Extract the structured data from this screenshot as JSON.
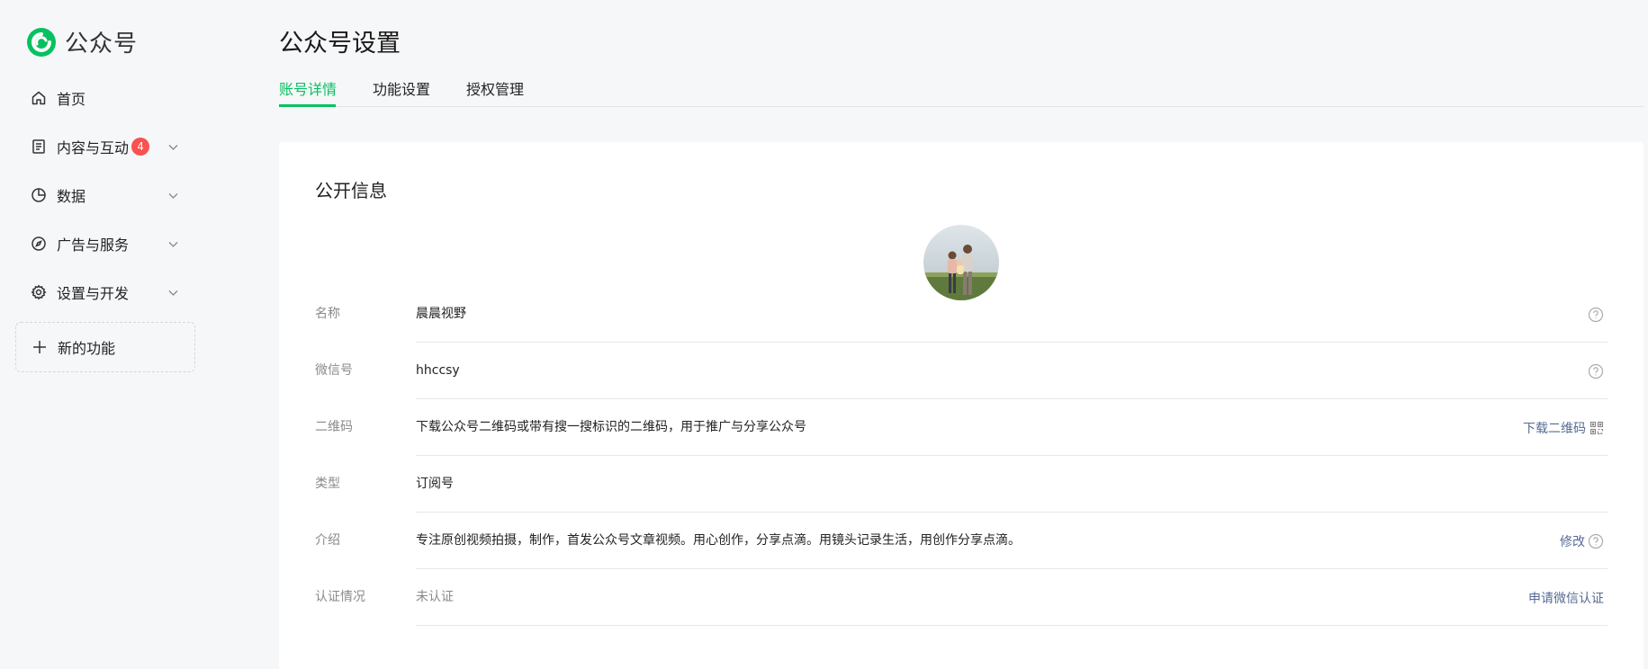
{
  "brand": {
    "name": "公众号",
    "accent": "#07c160"
  },
  "sidebar": {
    "items": [
      {
        "label": "首页",
        "icon": "home-icon",
        "expandable": false
      },
      {
        "label": "内容与互动",
        "icon": "document-icon",
        "badge": "4",
        "expandable": true
      },
      {
        "label": "数据",
        "icon": "pie-chart-icon",
        "expandable": true
      },
      {
        "label": "广告与服务",
        "icon": "compass-icon",
        "expandable": true
      },
      {
        "label": "设置与开发",
        "icon": "gear-icon",
        "expandable": true
      }
    ],
    "new_feature": {
      "label": "新的功能",
      "icon": "plus-icon"
    }
  },
  "page": {
    "title": "公众号设置",
    "tabs": [
      {
        "label": "账号详情",
        "active": true
      },
      {
        "label": "功能设置",
        "active": false
      },
      {
        "label": "授权管理",
        "active": false
      }
    ]
  },
  "public_info": {
    "title": "公开信息",
    "rows": [
      {
        "label": "名称",
        "value": "晨晨视野",
        "help": true
      },
      {
        "label": "微信号",
        "value": "hhccsy",
        "help": true
      },
      {
        "label": "二维码",
        "value": "下载公众号二维码或带有搜一搜标识的二维码，用于推广与分享公众号",
        "action": "下载二维码",
        "action_icon": "qr-code-icon"
      },
      {
        "label": "类型",
        "value": "订阅号"
      },
      {
        "label": "介绍",
        "value": "专注原创视频拍摄，制作，首发公众号文章视频。用心创作，分享点滴。用镜头记录生活，用创作分享点滴。",
        "action": "修改",
        "help": true
      },
      {
        "label": "认证情况",
        "value": "未认证",
        "action": "申请微信认证"
      }
    ]
  },
  "colors": {
    "link": "#576b95",
    "badge": "#fa5151",
    "label": "#8a8a8a"
  }
}
